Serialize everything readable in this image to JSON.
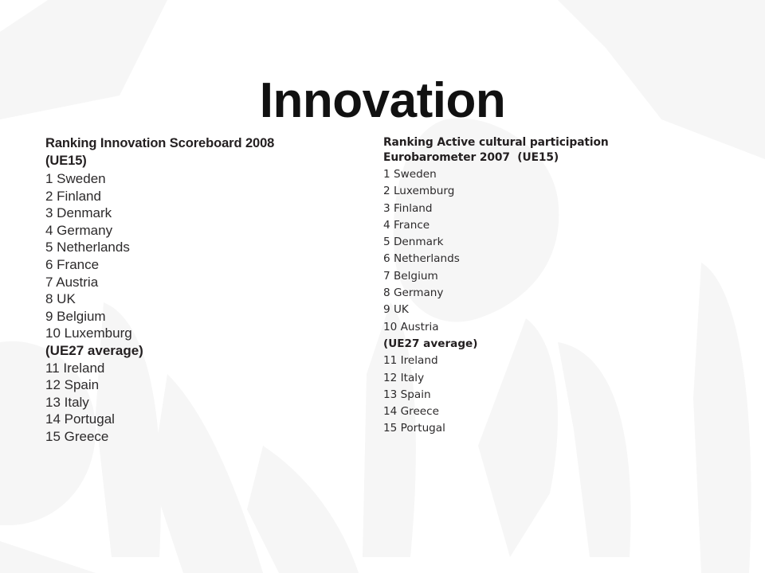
{
  "slide": {
    "title": "Innovation",
    "background_color": "#ffffff",
    "text_color": "#2c2a2b",
    "title_color": "#111111",
    "watermark_color": "#f6f6f6"
  },
  "left_column": {
    "heading_line1": "Ranking Innovation Scoreboard 2008",
    "heading_line2": "(UE15)",
    "items": [
      {
        "label": "1 Sweden",
        "emphasis": false
      },
      {
        "label": "2 Finland",
        "emphasis": false
      },
      {
        "label": "3 Denmark",
        "emphasis": false
      },
      {
        "label": "4 Germany",
        "emphasis": false
      },
      {
        "label": "5 Netherlands",
        "emphasis": false
      },
      {
        "label": "6 France",
        "emphasis": false
      },
      {
        "label": "7 Austria",
        "emphasis": false
      },
      {
        "label": "8 UK",
        "emphasis": false
      },
      {
        "label": "9 Belgium",
        "emphasis": false
      },
      {
        "label": "10 Luxemburg",
        "emphasis": false
      },
      {
        "label": "(UE27 average)",
        "emphasis": true
      },
      {
        "label": "11 Ireland",
        "emphasis": false
      },
      {
        "label": "12 Spain",
        "emphasis": false
      },
      {
        "label": "13 Italy",
        "emphasis": false
      },
      {
        "label": "14 Portugal",
        "emphasis": false
      },
      {
        "label": "15 Greece",
        "emphasis": false
      }
    ]
  },
  "right_column": {
    "heading_line1": "Ranking Active cultural participation",
    "heading_line2": "Eurobarometer 2007  (UE15)",
    "items": [
      {
        "label": "1 Sweden",
        "emphasis": false
      },
      {
        "label": "2 Luxemburg",
        "emphasis": false
      },
      {
        "label": "3 Finland",
        "emphasis": false
      },
      {
        "label": "4 France",
        "emphasis": false
      },
      {
        "label": "5 Denmark",
        "emphasis": false
      },
      {
        "label": "6 Netherlands",
        "emphasis": false
      },
      {
        "label": "7 Belgium",
        "emphasis": false
      },
      {
        "label": "8 Germany",
        "emphasis": false
      },
      {
        "label": "9 UK",
        "emphasis": false
      },
      {
        "label": "10 Austria",
        "emphasis": false
      },
      {
        "label": "(UE27 average)",
        "emphasis": true
      },
      {
        "label": "11 Ireland",
        "emphasis": false
      },
      {
        "label": "12 Italy",
        "emphasis": false
      },
      {
        "label": "13 Spain",
        "emphasis": false
      },
      {
        "label": "14 Greece",
        "emphasis": false
      },
      {
        "label": "15 Portugal",
        "emphasis": false
      }
    ]
  }
}
